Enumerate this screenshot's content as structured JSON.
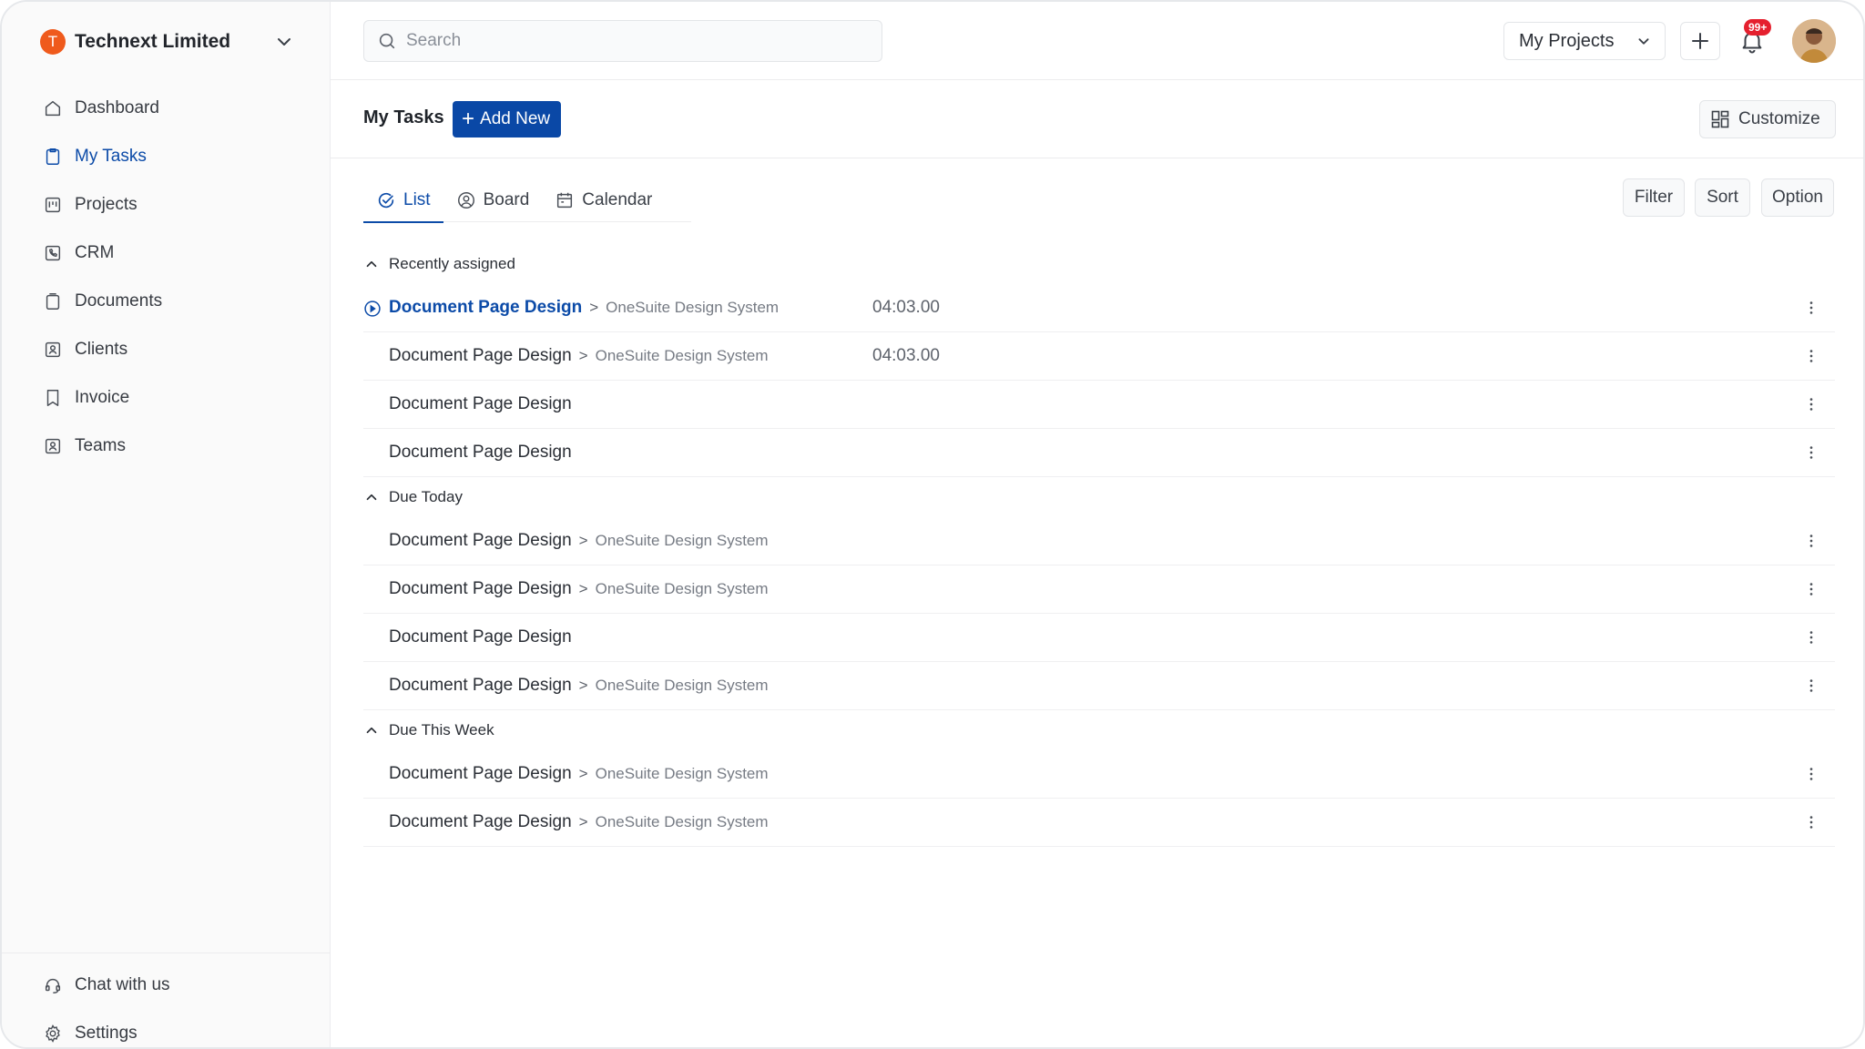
{
  "org": {
    "initial": "T",
    "name": "Technext Limited"
  },
  "sidebar": {
    "items": [
      {
        "label": "Dashboard",
        "icon": "home-icon"
      },
      {
        "label": "My Tasks",
        "icon": "clipboard-icon",
        "active": true
      },
      {
        "label": "Projects",
        "icon": "kanban-icon"
      },
      {
        "label": "CRM",
        "icon": "phone-icon"
      },
      {
        "label": "Documents",
        "icon": "document-icon"
      },
      {
        "label": "Clients",
        "icon": "contact-icon"
      },
      {
        "label": "Invoice",
        "icon": "bookmark-icon"
      },
      {
        "label": "Teams",
        "icon": "team-icon"
      }
    ],
    "bottom": [
      {
        "label": "Chat with us",
        "icon": "headset-icon"
      },
      {
        "label": "Settings",
        "icon": "gear-icon"
      }
    ]
  },
  "topbar": {
    "search_placeholder": "Search",
    "projects_label": "My Projects",
    "notification_count": "99+"
  },
  "page": {
    "title": "My Tasks",
    "add_label": "Add New",
    "customize_label": "Customize"
  },
  "tabs": [
    {
      "label": "List",
      "active": true
    },
    {
      "label": "Board"
    },
    {
      "label": "Calendar"
    }
  ],
  "toolbar": {
    "filter": "Filter",
    "sort": "Sort",
    "option": "Option"
  },
  "groups": [
    {
      "title": "Recently assigned",
      "tasks": [
        {
          "title": "Document Page Design",
          "project": "OneSuite Design System",
          "time": "04:03.00",
          "highlight": true
        },
        {
          "title": "Document Page Design",
          "project": "OneSuite Design System",
          "time": "04:03.00"
        },
        {
          "title": "Document Page Design"
        },
        {
          "title": "Document Page Design"
        }
      ]
    },
    {
      "title": "Due Today",
      "tasks": [
        {
          "title": "Document Page Design",
          "project": "OneSuite Design System"
        },
        {
          "title": "Document Page Design",
          "project": "OneSuite Design System"
        },
        {
          "title": "Document Page Design"
        },
        {
          "title": "Document Page Design",
          "project": "OneSuite Design System"
        }
      ]
    },
    {
      "title": "Due This Week",
      "tasks": [
        {
          "title": "Document Page Design",
          "project": "OneSuite Design System"
        },
        {
          "title": "Document Page Design",
          "project": "OneSuite Design System"
        }
      ]
    }
  ],
  "colors": {
    "accent": "#0a48a6",
    "org_badge": "#ef5a1c",
    "notification": "#e5202e"
  }
}
